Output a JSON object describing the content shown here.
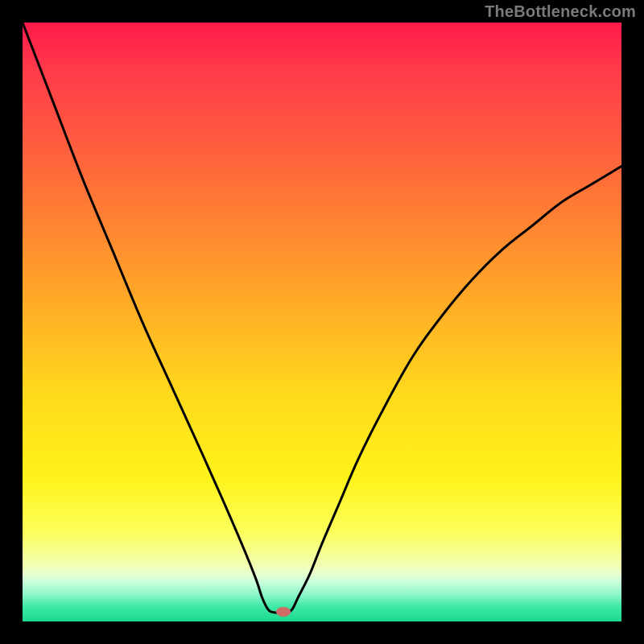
{
  "attribution": "TheBottleneck.com",
  "plot": {
    "inner_left": 28,
    "inner_top": 28,
    "inner_width": 744,
    "inner_height": 744
  },
  "chart_data": {
    "type": "line",
    "title": "",
    "xlabel": "",
    "ylabel": "",
    "xlim": [
      0,
      100
    ],
    "ylim": [
      0,
      100
    ],
    "notch_x": 42,
    "marker": {
      "x": 43.5,
      "y": 1.6,
      "color": "#cf6a65"
    },
    "series": [
      {
        "name": "bottleneck-curve",
        "x": [
          0,
          5,
          10,
          15,
          20,
          25,
          30,
          34,
          37,
          39,
          40,
          41,
          42,
          43,
          44,
          45,
          46,
          48,
          50,
          53,
          56,
          60,
          65,
          70,
          75,
          80,
          85,
          90,
          95,
          100
        ],
        "values": [
          100,
          87,
          74,
          62,
          50,
          39,
          28,
          19,
          12,
          7,
          4,
          2,
          1.5,
          1.5,
          1.5,
          2,
          4,
          8,
          13,
          20,
          27,
          35,
          44,
          51,
          57,
          62,
          66,
          70,
          73,
          76
        ]
      }
    ]
  }
}
